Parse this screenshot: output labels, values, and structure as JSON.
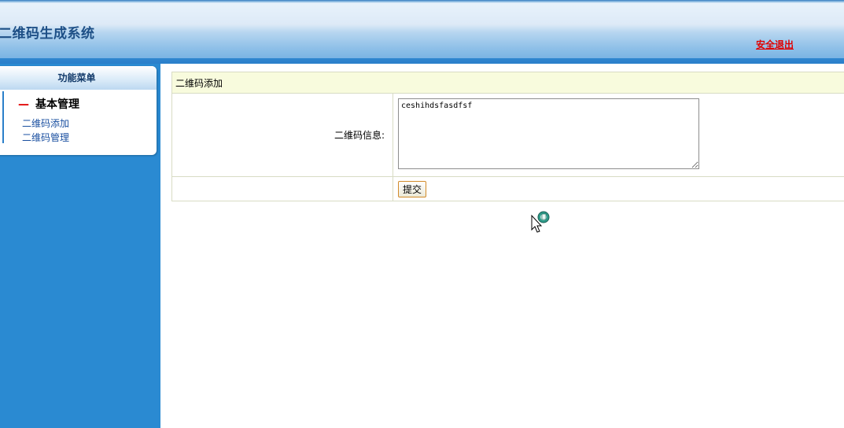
{
  "header": {
    "title": "二维码生成系统",
    "logout_label": "安全退出"
  },
  "sidebar": {
    "menu_title": "功能菜单",
    "group": {
      "title": "基本管理",
      "items": [
        {
          "label": "二维码添加"
        },
        {
          "label": "二维码管理"
        }
      ]
    }
  },
  "form": {
    "heading": "二维码添加",
    "info_label": "二维码信息:",
    "info_value": "ceshihdsfasdfsf",
    "submit_label": "提交"
  },
  "colors": {
    "header_blue": "#79b3e3",
    "sidebar_blue": "#2a8ad2",
    "logout_red": "#e00000",
    "form_head_bg": "#f8fbdd"
  }
}
